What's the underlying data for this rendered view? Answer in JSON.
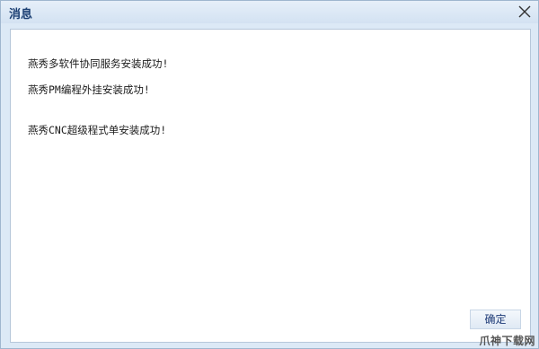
{
  "dialog": {
    "title": "消息",
    "messages": [
      "燕秀多软件协同服务安装成功!",
      "燕秀PM编程外挂安装成功!",
      "燕秀CNC超级程式单安装成功!"
    ],
    "ok_label": "确定",
    "close_icon": "close-icon"
  },
  "watermark": {
    "text": "爪神下载网"
  },
  "colors": {
    "title_text": "#1b3f73",
    "frame": "#dce9f6",
    "client_bg": "#ffffff",
    "ok_text": "#1f3c78"
  }
}
